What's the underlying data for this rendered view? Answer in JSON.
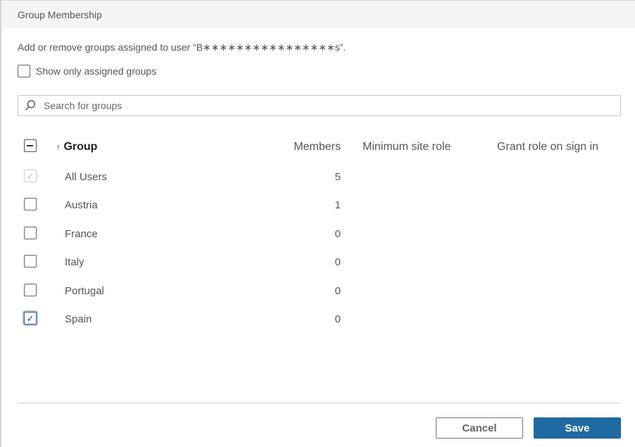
{
  "dialog": {
    "title": "Group Membership",
    "description": "Add or remove groups assigned to user “B∗∗∗∗∗∗∗∗∗∗∗∗∗∗∗∗s”."
  },
  "filter": {
    "show_only_assigned_label": "Show only assigned groups",
    "show_only_assigned_checked": false
  },
  "search": {
    "icon": "search-icon",
    "placeholder": "Search for groups",
    "value": ""
  },
  "table": {
    "select_all_state": "indeterminate",
    "columns": [
      {
        "key": "group",
        "label": "Group",
        "sort": "ascending",
        "sort_icon": "↑"
      },
      {
        "key": "members",
        "label": "Members"
      },
      {
        "key": "min_site_role",
        "label": "Minimum site role"
      },
      {
        "key": "grant_role",
        "label": "Grant role on sign in"
      }
    ],
    "rows": [
      {
        "name": "All Users",
        "members": "5",
        "checked": true,
        "disabled": true,
        "min_site_role": "",
        "grant_role": ""
      },
      {
        "name": "Austria",
        "members": "1",
        "checked": false,
        "disabled": false,
        "min_site_role": "",
        "grant_role": ""
      },
      {
        "name": "France",
        "members": "0",
        "checked": false,
        "disabled": false,
        "min_site_role": "",
        "grant_role": ""
      },
      {
        "name": "Italy",
        "members": "0",
        "checked": false,
        "disabled": false,
        "min_site_role": "",
        "grant_role": ""
      },
      {
        "name": "Portugal",
        "members": "0",
        "checked": false,
        "disabled": false,
        "min_site_role": "",
        "grant_role": ""
      },
      {
        "name": "Spain",
        "members": "0",
        "checked": true,
        "disabled": false,
        "focused": true,
        "min_site_role": "",
        "grant_role": ""
      }
    ]
  },
  "footer": {
    "cancel_label": "Cancel",
    "save_label": "Save"
  },
  "colors": {
    "primary": "#1f6aa1",
    "focus_ring": "#4296e6"
  }
}
